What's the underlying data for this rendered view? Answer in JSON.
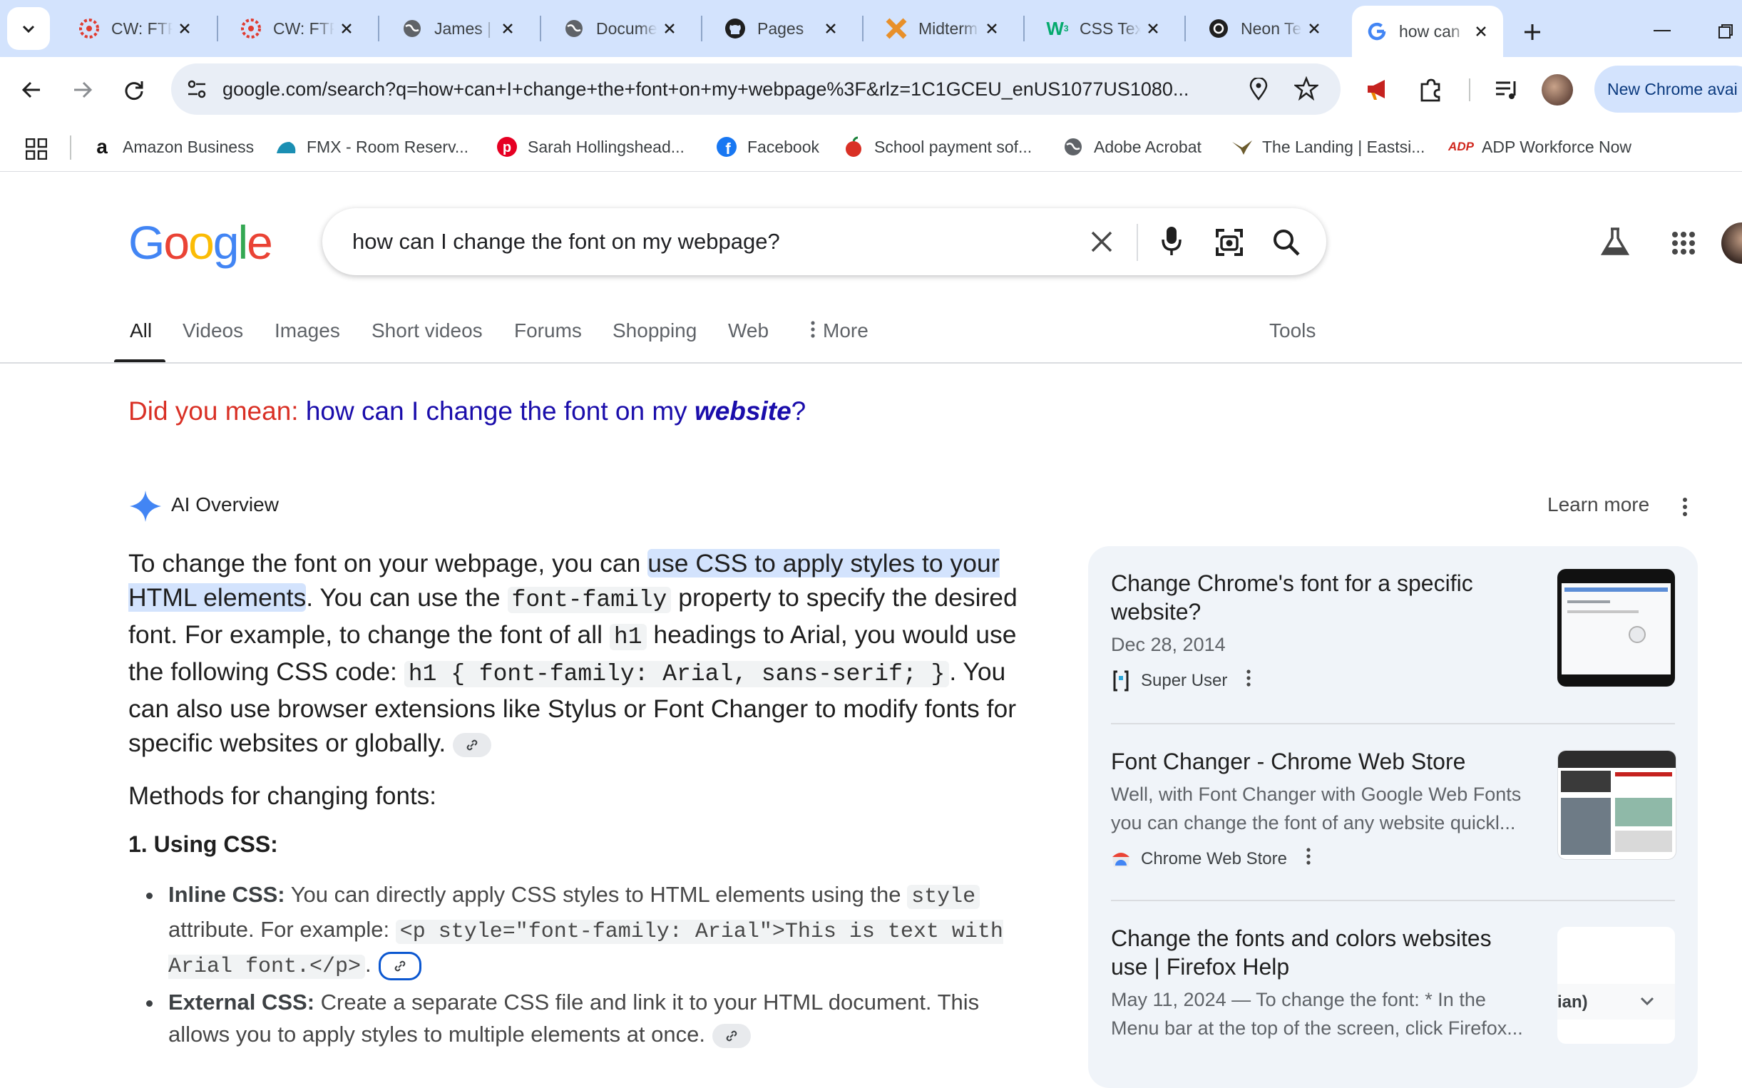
{
  "tabs": [
    {
      "title": "CW: FTP",
      "icon": "canvas-icon"
    },
    {
      "title": "CW: FTP",
      "icon": "canvas-icon"
    },
    {
      "title": "James |",
      "icon": "globe-icon"
    },
    {
      "title": "Docume",
      "icon": "globe-icon"
    },
    {
      "title": "Pages",
      "icon": "github-icon"
    },
    {
      "title": "Midterm",
      "icon": "x-logo-icon"
    },
    {
      "title": "CSS Tex",
      "icon": "w3schools-icon"
    },
    {
      "title": "Neon Te",
      "icon": "openai-icon"
    },
    {
      "title": "how can",
      "icon": "google-icon"
    }
  ],
  "address_bar": {
    "url": "google.com/search?q=how+can+I+change+the+font+on+my+webpage%3F&rlz=1C1GCEU_enUS1077US1080..."
  },
  "toolbar": {
    "chrome_update_label": "New Chrome avai"
  },
  "bookmarks": [
    {
      "label": "Amazon Business",
      "icon": "amazon-icon"
    },
    {
      "label": "FMX - Room Reserv...",
      "icon": "fmx-icon"
    },
    {
      "label": "Sarah Hollingshead...",
      "icon": "pinterest-icon"
    },
    {
      "label": "Facebook",
      "icon": "facebook-icon"
    },
    {
      "label": "School payment sof...",
      "icon": "apple-icon"
    },
    {
      "label": "Adobe Acrobat",
      "icon": "globe-icon"
    },
    {
      "label": "The Landing | Eastsi...",
      "icon": "eagle-icon"
    },
    {
      "label": "ADP Workforce Now",
      "icon": "adp-icon"
    }
  ],
  "google": {
    "logo": "Google",
    "query": "how can I change the font on my webpage?",
    "nav": [
      "All",
      "Videos",
      "Images",
      "Short videos",
      "Forums",
      "Shopping",
      "Web",
      "More"
    ],
    "tools_label": "Tools",
    "did_you_mean_label": "Did you mean:",
    "did_you_mean_prefix": "how can I change the font on my ",
    "did_you_mean_bold": "website",
    "did_you_mean_suffix": "?"
  },
  "ai_overview": {
    "label": "AI Overview",
    "learn_more": "Learn more",
    "p1_a": "To change the font on your webpage, you can ",
    "p1_hl": "use CSS to apply styles to your HTML elements",
    "p1_b": ". You can use the ",
    "p1_code1": "font-family",
    "p1_c": " property to specify the desired font. For example, to change the font of all ",
    "p1_code2": "h1",
    "p1_d": " headings to Arial, you would use the following CSS code: ",
    "p1_code3": "h1 { font-family: Arial, sans-serif; }",
    "p1_e": ". You can also use browser extensions like Stylus or Font Changer to modify fonts for specific websites or globally.",
    "methods_heading": "Methods for changing fonts:",
    "sub1": "1. Using CSS:",
    "b1_bold": "Inline CSS:",
    "b1_a": " You can directly apply CSS styles to HTML elements using the ",
    "b1_code1": "style",
    "b1_b": " attribute. For example: ",
    "b1_code2": "<p style=\"font-family: Arial\">This is text with Arial font.</p>",
    "b1_c": ".",
    "b2_bold": "External CSS:",
    "b2_a": " Create a separate CSS file and link it to your HTML document. This allows you to apply styles to multiple elements at once."
  },
  "sources": [
    {
      "title": "Change Chrome's font for a specific website?",
      "date": "Dec 28, 2014",
      "source": "Super User"
    },
    {
      "title": "Font Changer - Chrome Web Store",
      "snippet": "Well, with Font Changer with Google Web Fonts you can change the font of any website quickl...",
      "source": "Chrome Web Store"
    },
    {
      "title": "Change the fonts and colors websites use | Firefox Help",
      "snippet": "May 11, 2024 — To change the font: * In the Menu bar at the top of the screen, click Firefox...",
      "thumb_text": "ian)"
    }
  ],
  "colors": {
    "accent": "#1a0dab",
    "did_you_mean": "#d93025",
    "tab_strip": "#d3e3fd",
    "highlight": "#d3e3fd"
  }
}
